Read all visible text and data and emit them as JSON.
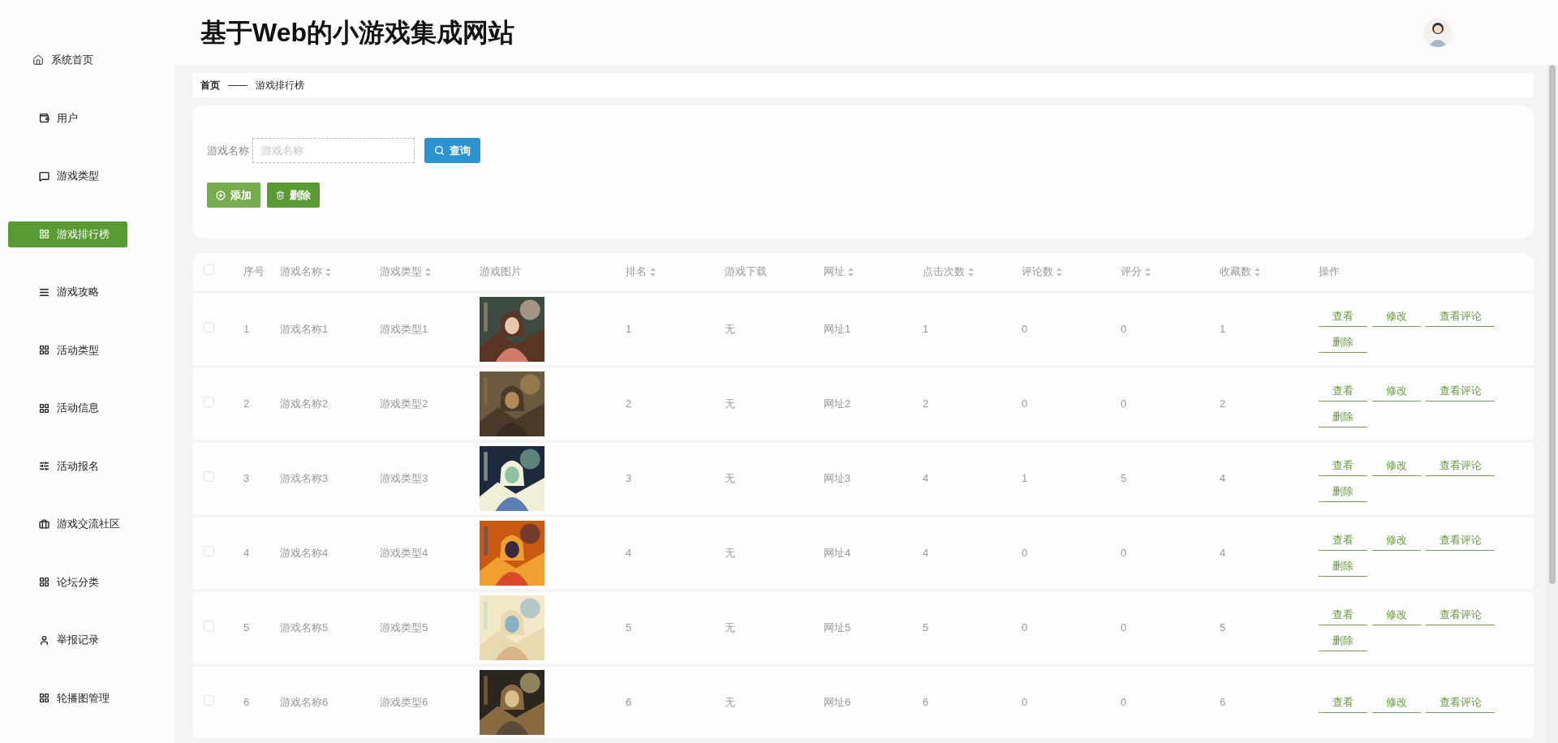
{
  "site_title": "基于Web的小游戏集成网站",
  "sidebar": {
    "items": [
      {
        "label": "系统首页",
        "selected": false
      },
      {
        "label": "用户",
        "selected": false
      },
      {
        "label": "游戏类型",
        "selected": false
      },
      {
        "label": "游戏排行榜",
        "selected": true
      },
      {
        "label": "游戏攻略",
        "selected": false
      },
      {
        "label": "活动类型",
        "selected": false
      },
      {
        "label": "活动信息",
        "selected": false
      },
      {
        "label": "活动报名",
        "selected": false
      },
      {
        "label": "游戏交流社区",
        "selected": false
      },
      {
        "label": "论坛分类",
        "selected": false
      },
      {
        "label": "举报记录",
        "selected": false
      },
      {
        "label": "轮播图管理",
        "selected": false
      }
    ]
  },
  "breadcrumb": {
    "home": "首页",
    "separator": "——",
    "current": "游戏排行榜"
  },
  "search": {
    "label": "游戏名称",
    "placeholder": "游戏名称",
    "button": "查询"
  },
  "actions": [
    {
      "label": "添加",
      "kind": "add"
    },
    {
      "label": "删除",
      "kind": "delete"
    }
  ],
  "table": {
    "select_all": {
      "checked": false
    },
    "columns": [
      {
        "label": "序号",
        "sortable": false
      },
      {
        "label": "游戏名称",
        "sortable": true
      },
      {
        "label": "游戏类型",
        "sortable": true
      },
      {
        "label": "游戏图片",
        "sortable": false
      },
      {
        "label": "排名",
        "sortable": true
      },
      {
        "label": "游戏下载",
        "sortable": false
      },
      {
        "label": "网址",
        "sortable": true
      },
      {
        "label": "点击次数",
        "sortable": true
      },
      {
        "label": "评论数",
        "sortable": true
      },
      {
        "label": "评分",
        "sortable": true
      },
      {
        "label": "收藏数",
        "sortable": true
      },
      {
        "label": "操作",
        "sortable": false
      }
    ],
    "rows": [
      {
        "checked": false,
        "index": "1",
        "name": "游戏名称1",
        "type": "游戏类型1",
        "rank": "1",
        "download": "无",
        "url": "网址1",
        "clicks": "1",
        "comments": "0",
        "score": "0",
        "favorites": "1",
        "actions": [
          "查看",
          "修改",
          "查看评论",
          "删除"
        ]
      },
      {
        "checked": false,
        "index": "2",
        "name": "游戏名称2",
        "type": "游戏类型2",
        "rank": "2",
        "download": "无",
        "url": "网址2",
        "clicks": "2",
        "comments": "0",
        "score": "0",
        "favorites": "2",
        "actions": [
          "查看",
          "修改",
          "查看评论",
          "删除"
        ]
      },
      {
        "checked": false,
        "index": "3",
        "name": "游戏名称3",
        "type": "游戏类型3",
        "rank": "3",
        "download": "无",
        "url": "网址3",
        "clicks": "4",
        "comments": "1",
        "score": "5",
        "favorites": "4",
        "actions": [
          "查看",
          "修改",
          "查看评论",
          "删除"
        ]
      },
      {
        "checked": false,
        "index": "4",
        "name": "游戏名称4",
        "type": "游戏类型4",
        "rank": "4",
        "download": "无",
        "url": "网址4",
        "clicks": "4",
        "comments": "0",
        "score": "0",
        "favorites": "4",
        "actions": [
          "查看",
          "修改",
          "查看评论",
          "删除"
        ]
      },
      {
        "checked": false,
        "index": "5",
        "name": "游戏名称5",
        "type": "游戏类型5",
        "rank": "5",
        "download": "无",
        "url": "网址5",
        "clicks": "5",
        "comments": "0",
        "score": "0",
        "favorites": "5",
        "actions": [
          "查看",
          "修改",
          "查看评论",
          "删除"
        ]
      },
      {
        "checked": false,
        "index": "6",
        "name": "游戏名称6",
        "type": "游戏类型6",
        "rank": "6",
        "download": "无",
        "url": "网址6",
        "clicks": "6",
        "comments": "0",
        "score": "0",
        "favorites": "6",
        "actions": [
          "查看",
          "修改",
          "查看评论"
        ]
      }
    ]
  }
}
